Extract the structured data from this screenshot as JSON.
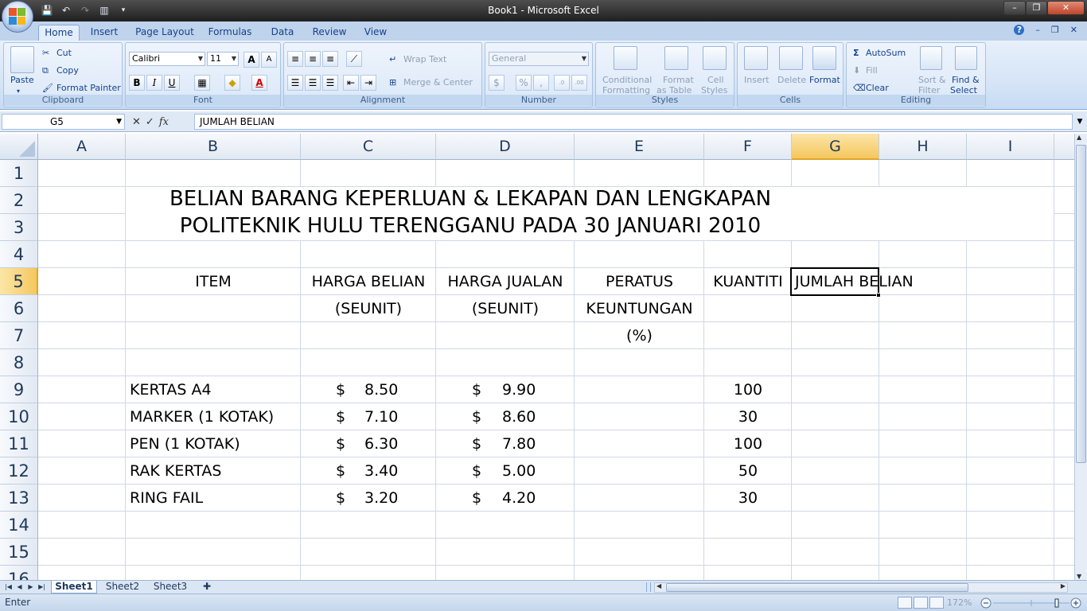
{
  "window": {
    "title": "Book1 - Microsoft Excel",
    "minimize": "–",
    "maximize": "❐",
    "close": "✕"
  },
  "ribbon_tabs": [
    "Home",
    "Insert",
    "Page Layout",
    "Formulas",
    "Data",
    "Review",
    "View"
  ],
  "ribbon_right": {
    "help": "?",
    "min": "–",
    "restore": "❐",
    "close": "✕"
  },
  "clipboard": {
    "paste": "Paste",
    "cut": "Cut",
    "copy": "Copy",
    "format_painter": "Format Painter",
    "label": "Clipboard"
  },
  "font": {
    "family": "Calibri",
    "size": "11",
    "grow": "A",
    "shrink": "A",
    "bold": "B",
    "italic": "I",
    "underline": "U",
    "label": "Font"
  },
  "alignment": {
    "wrap_text": "Wrap Text",
    "merge_center": "Merge & Center",
    "label": "Alignment"
  },
  "number": {
    "format": "General",
    "currency": "$",
    "percent": "%",
    "comma": ",",
    "inc_decimal": ".0 .00",
    "dec_decimal": ".00 .0",
    "label": "Number"
  },
  "styles": {
    "conditional": "Conditional",
    "conditional2": "Formatting",
    "format_table": "Format",
    "format_table2": "as Table",
    "cell_styles": "Cell",
    "cell_styles2": "Styles",
    "label": "Styles"
  },
  "cells": {
    "insert": "Insert",
    "delete": "Delete",
    "format": "Format",
    "label": "Cells"
  },
  "editing": {
    "autosum": "AutoSum",
    "fill": "Fill",
    "clear": "Clear",
    "sort": "Sort &",
    "sort2": "Filter",
    "find": "Find &",
    "find2": "Select",
    "label": "Editing"
  },
  "formula_bar": {
    "name_box": "G5",
    "fx": "fx",
    "cancel": "✕",
    "enter": "✓",
    "content": "JUMLAH BELIAN"
  },
  "columns": [
    "A",
    "B",
    "C",
    "D",
    "E",
    "F",
    "G",
    "H",
    "I"
  ],
  "rows": [
    "1",
    "2",
    "3",
    "4",
    "5",
    "6",
    "7",
    "8",
    "9",
    "10",
    "11",
    "12",
    "13",
    "14",
    "15",
    "16"
  ],
  "sheet": {
    "title1": "BELIAN BARANG KEPERLUAN & LEKAPAN DAN LENGKAPAN",
    "title2": "POLITEKNIK HULU TERENGGANU PADA 30 JANUARI 2010",
    "headers": {
      "item": "ITEM",
      "harga_belian": "HARGA BELIAN",
      "harga_belian2": "(SEUNIT)",
      "harga_jualan": "HARGA JUALAN",
      "harga_jualan2": "(SEUNIT)",
      "peratus": "PERATUS",
      "peratus2": "KEUNTUNGAN",
      "peratus3": "(%)",
      "kuantiti": "KUANTITI",
      "jumlah": "JUMLAH BELIAN"
    },
    "currency_symbol": "$",
    "items": [
      {
        "name": "KERTAS A4",
        "belian": "8.50",
        "jualan": "9.90",
        "kuantiti": "100"
      },
      {
        "name": "MARKER (1 KOTAK)",
        "belian": "7.10",
        "jualan": "8.60",
        "kuantiti": "30"
      },
      {
        "name": "PEN (1 KOTAK)",
        "belian": "6.30",
        "jualan": "7.80",
        "kuantiti": "100"
      },
      {
        "name": "RAK KERTAS",
        "belian": "3.40",
        "jualan": "5.00",
        "kuantiti": "50"
      },
      {
        "name": "RING FAIL",
        "belian": "3.20",
        "jualan": "4.20",
        "kuantiti": "30"
      }
    ]
  },
  "sheet_tabs": [
    "Sheet1",
    "Sheet2",
    "Sheet3"
  ],
  "status": {
    "mode": "Enter",
    "zoom": "172%"
  },
  "colors": {
    "accent": "#15428b",
    "selected_header": "#f5c75f",
    "ribbon_bg": "#dbe8f8"
  }
}
